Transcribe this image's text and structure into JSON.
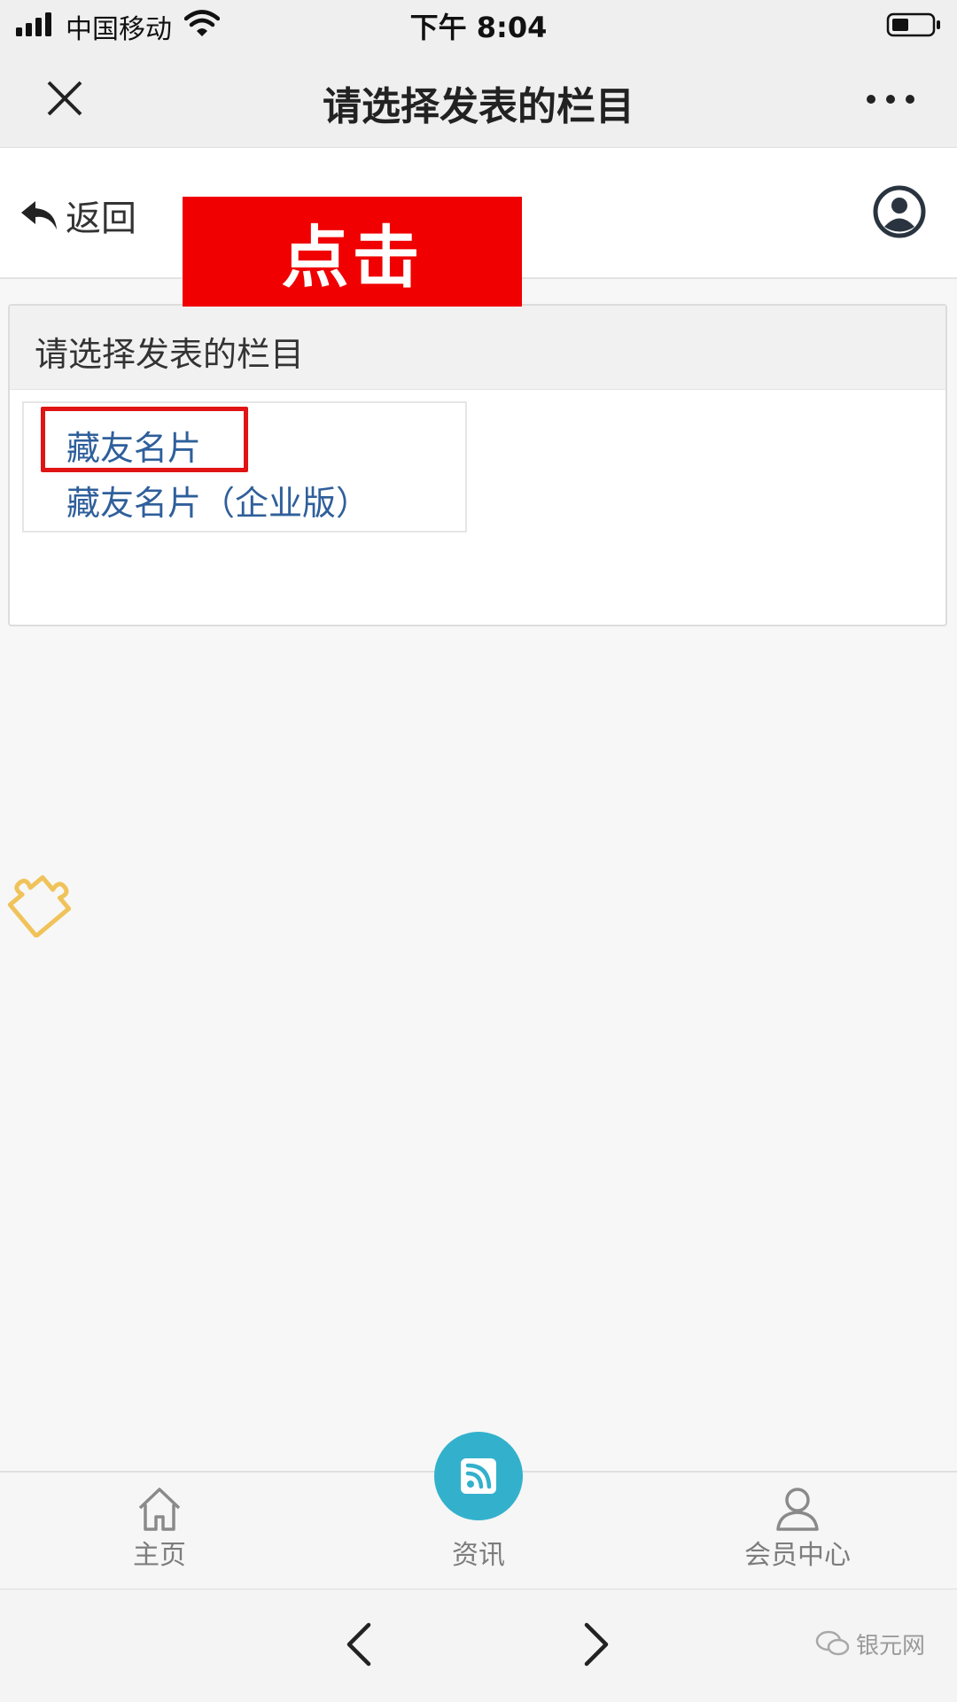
{
  "status_bar": {
    "carrier": "中国移动",
    "time": "下午 8:04",
    "icons": [
      "signal-icon",
      "wifi-icon",
      "battery-icon"
    ]
  },
  "title_bar": {
    "title": "请选择发表的栏目",
    "icons": [
      "close-icon",
      "more-icon"
    ]
  },
  "header": {
    "back_label": "返回",
    "icons": [
      "back-arrow-icon",
      "user-avatar-icon"
    ]
  },
  "annotation": {
    "banner_text": "点击",
    "banner_color": "#f00000",
    "highlight_color": "#e01414"
  },
  "panel": {
    "title": "请选择发表的栏目",
    "categories": [
      {
        "label": "藏友名片"
      },
      {
        "label": "藏友名片（企业版）"
      }
    ]
  },
  "floating": {
    "icon": "puzzle-icon",
    "color": "#f0c35a"
  },
  "tab_bar": {
    "items": [
      {
        "label": "主页",
        "icon": "home-icon"
      },
      {
        "label": "资讯",
        "icon": "rss-icon",
        "accent": "#33b1cc"
      },
      {
        "label": "会员中心",
        "icon": "user-icon"
      }
    ]
  },
  "browser_nav": {
    "icons": [
      "back-chevron-icon",
      "forward-chevron-icon"
    ]
  },
  "watermark": {
    "text": "银元网",
    "icon": "wechat-icon"
  },
  "colors": {
    "link": "#2f5f9b",
    "accent": "#33b1cc"
  }
}
